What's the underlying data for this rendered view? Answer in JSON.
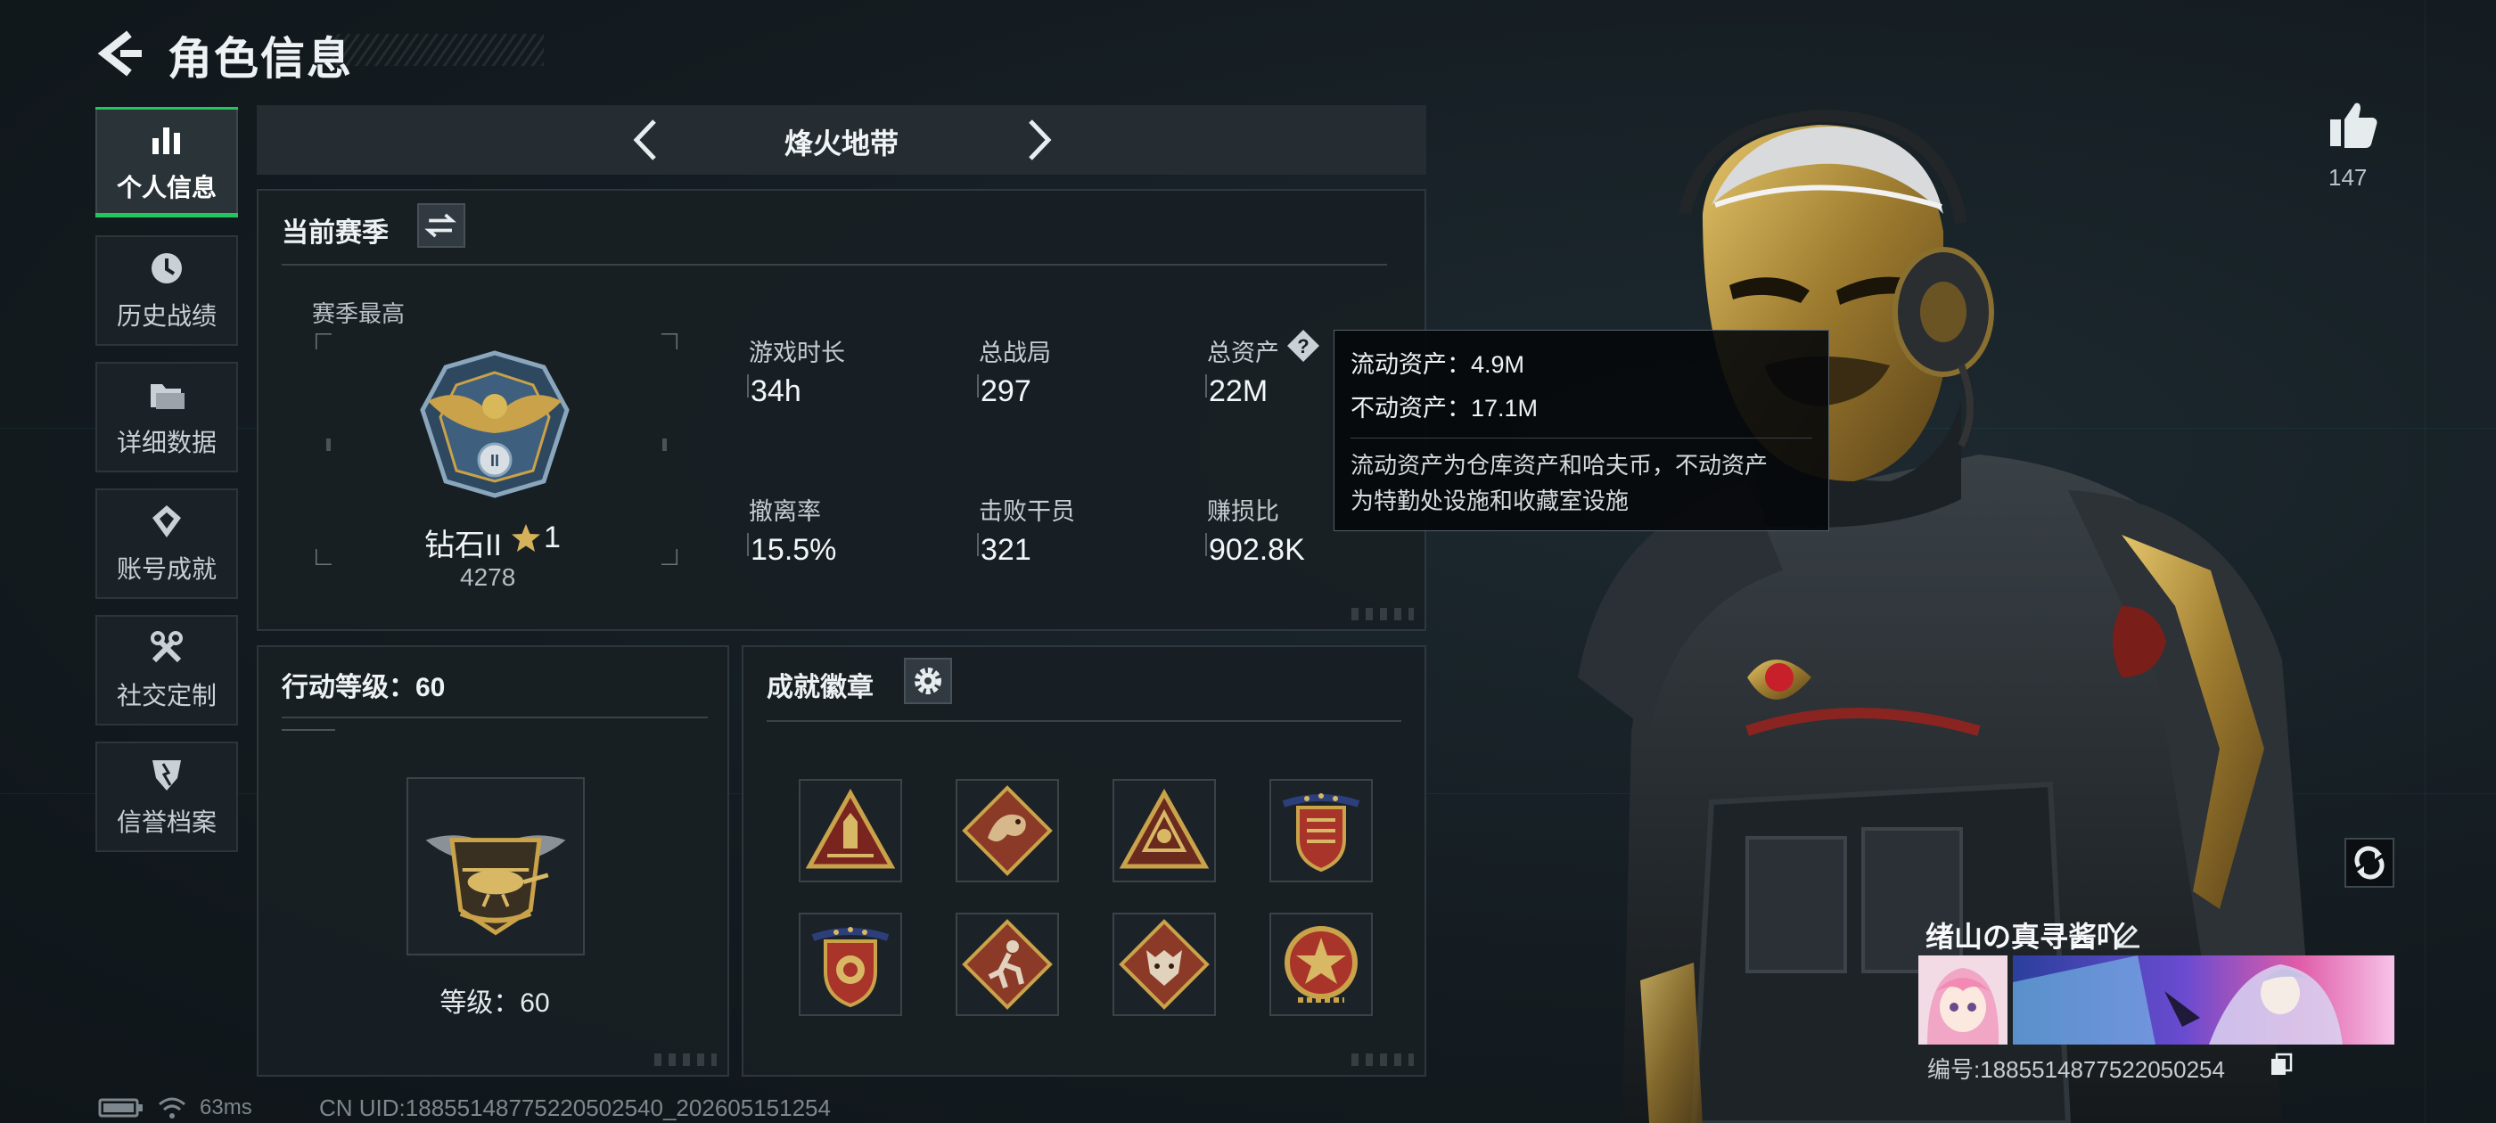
{
  "header": {
    "title": "角色信息",
    "back_icon": "back-arrow-icon"
  },
  "sidebar": {
    "items": [
      {
        "label": "个人信息",
        "icon": "bar-chart-icon",
        "active": true
      },
      {
        "label": "历史战绩",
        "icon": "history-clock-icon",
        "active": false
      },
      {
        "label": "详细数据",
        "icon": "folder-icon",
        "active": false
      },
      {
        "label": "账号成就",
        "icon": "achievement-icon",
        "active": false
      },
      {
        "label": "社交定制",
        "icon": "tools-icon",
        "active": false
      },
      {
        "label": "信誉档案",
        "icon": "shield-icon",
        "active": false
      }
    ]
  },
  "mode_selector": {
    "label": "烽火地带"
  },
  "season": {
    "title": "当前赛季",
    "best_label": "赛季最高",
    "rank_name": "钻石II",
    "rank_stars": "1",
    "rank_score": "4278",
    "stats": [
      {
        "label": "游戏时长",
        "value": "34h"
      },
      {
        "label": "总战局",
        "value": "297"
      },
      {
        "label": "总资产",
        "value": "22M"
      },
      {
        "label": "撤离率",
        "value": "15.5%"
      },
      {
        "label": "击败干员",
        "value": "321"
      },
      {
        "label": "赚损比",
        "value": "902.8K"
      }
    ]
  },
  "tooltip": {
    "liquid": "流动资产：4.9M",
    "fixed": "不动资产：17.1M",
    "desc_line1": "流动资产为仓库资产和哈夫币，不动资产",
    "desc_line2": "为特勤处设施和收藏室设施"
  },
  "action_level": {
    "title": "行动等级：60",
    "level_text": "等级：60"
  },
  "achievements": {
    "title": "成就徽章",
    "badges": [
      {
        "icon": "triangle-ammo-badge-icon"
      },
      {
        "icon": "dragon-diamond-badge-icon"
      },
      {
        "icon": "triangle-emblem-badge-icon"
      },
      {
        "icon": "winged-shield-badge-icon"
      },
      {
        "icon": "starred-shield-badge-icon"
      },
      {
        "icon": "runner-diamond-badge-icon"
      },
      {
        "icon": "wolf-diamond-badge-icon"
      },
      {
        "icon": "star-medal-badge-icon"
      }
    ]
  },
  "profile": {
    "likes": "147",
    "player_name": "绪山の真寻酱吖",
    "player_id": "编号:1885514877522050254"
  },
  "status": {
    "ping": "63ms",
    "uid": "CN UID:18855148775220502540_202605151254"
  },
  "colors": {
    "accent_green": "#22c55e",
    "gold": "#c9a24a",
    "badge_red": "#8c2a24"
  }
}
